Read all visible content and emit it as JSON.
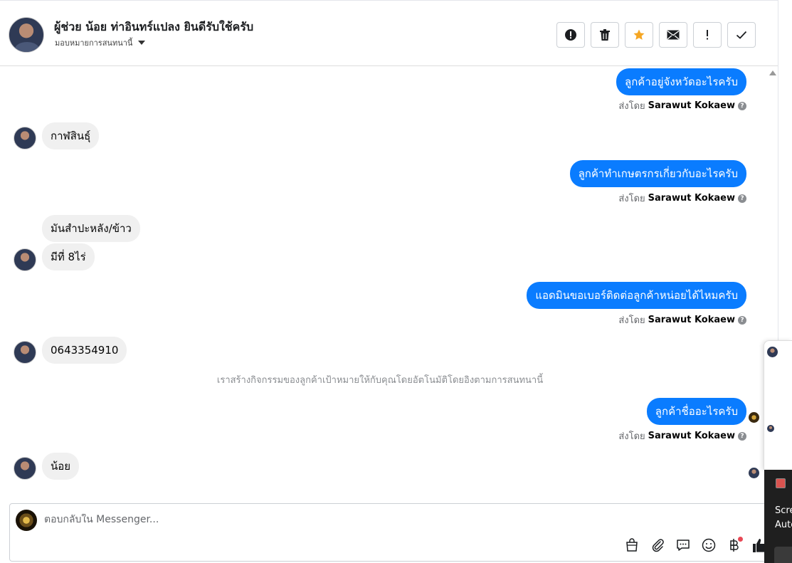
{
  "header": {
    "title": "ผู้ช่วย น้อย ท่าอินทร์แปลง ยินดีรับใช้ครับ",
    "subtitle": "มอบหมายการสนทนานี้"
  },
  "actions": [
    {
      "name": "report-icon",
      "label": "!"
    },
    {
      "name": "trash-icon",
      "label": ""
    },
    {
      "name": "star-icon",
      "label": ""
    },
    {
      "name": "mail-icon",
      "label": ""
    },
    {
      "name": "exclamation-icon",
      "label": "!"
    },
    {
      "name": "check-icon",
      "label": ""
    }
  ],
  "messages": {
    "m1": "ลูกค้าอยู่จังหวัดอะไรครับ",
    "m2": "กาฬสินธุ์",
    "m3": "ลูกค้าทำเกษตรกรเกี่ยวกับอะไรครับ",
    "m4": "มันสำปะหลัง/ข้าว",
    "m5": "มีที่ 8ไร่",
    "m6": "แอดมินขอเบอร์ติดต่อลูกค้าหน่อยได้ไหมครับ",
    "m7": "0643354910",
    "m8": "ลูกค้าชื่ออะไรครับ",
    "m9": "น้อย"
  },
  "sent_by": {
    "prefix": "ส่งโดย",
    "name": "Sarawut Kokaew",
    "help": "?"
  },
  "system_note": "เราสร้างกิจกรรมของลูกค้าเป้าหมายให้กับคุณโดยอัตโนมัติโดยอิงตามการสนทนานี้",
  "composer": {
    "placeholder": "ตอบกลับใน Messenger..."
  },
  "tools": [
    "shopping-bag-icon",
    "paperclip-icon",
    "chat-bubble-icon",
    "emoji-icon",
    "baht-icon",
    "thumbs-up-icon"
  ],
  "side_panel": {
    "line1": "Scre",
    "line2": "Auto"
  },
  "colors": {
    "outgoing": "#0a7cff",
    "incoming": "#f0f0f0",
    "accent_star": "#f5a623"
  }
}
